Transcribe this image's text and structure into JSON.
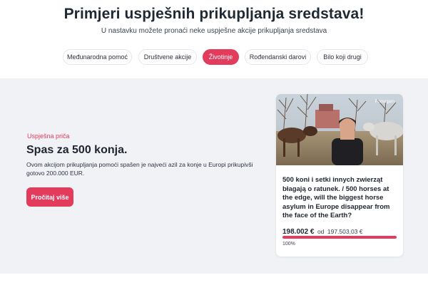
{
  "header": {
    "title": "Primjeri uspješnih prikupljanja sredstava!",
    "subtitle": "U nastavku možete pronaći neke uspješne akcije prikupljanja sredstava"
  },
  "tabs": [
    {
      "label": "Međunarodna pomoć",
      "active": false
    },
    {
      "label": "Društvene akcije",
      "active": false
    },
    {
      "label": "Životinje",
      "active": true
    },
    {
      "label": "Rođendanski darovi",
      "active": false
    },
    {
      "label": "Bilo koji drugi",
      "active": false
    }
  ],
  "story": {
    "tag": "Uspješna priča",
    "title": "Spas za 500 konja.",
    "description": "Ovom akcijom prikupljanja pomoći spašen je najveći azil za konje u Europi prikupivši gotovo 200.000 EUR.",
    "button_label": "Pročitaj više"
  },
  "card": {
    "campaign_title": "500 koni i setki innych zwierząt błagają o ratunek. / 500 horses at the edge, will the biggest horse asylum in Europe disappear from the face of the Earth?",
    "raised": "198.002 €",
    "of_label": "od",
    "goal": "197.503,03 €",
    "progress_fraction": 1.0,
    "percent_label": "100%",
    "image_watermark": "Pomagam"
  },
  "colors": {
    "accent": "#e23b5c",
    "band_bg": "#f1f2f5",
    "text_dark": "#1f2430"
  }
}
